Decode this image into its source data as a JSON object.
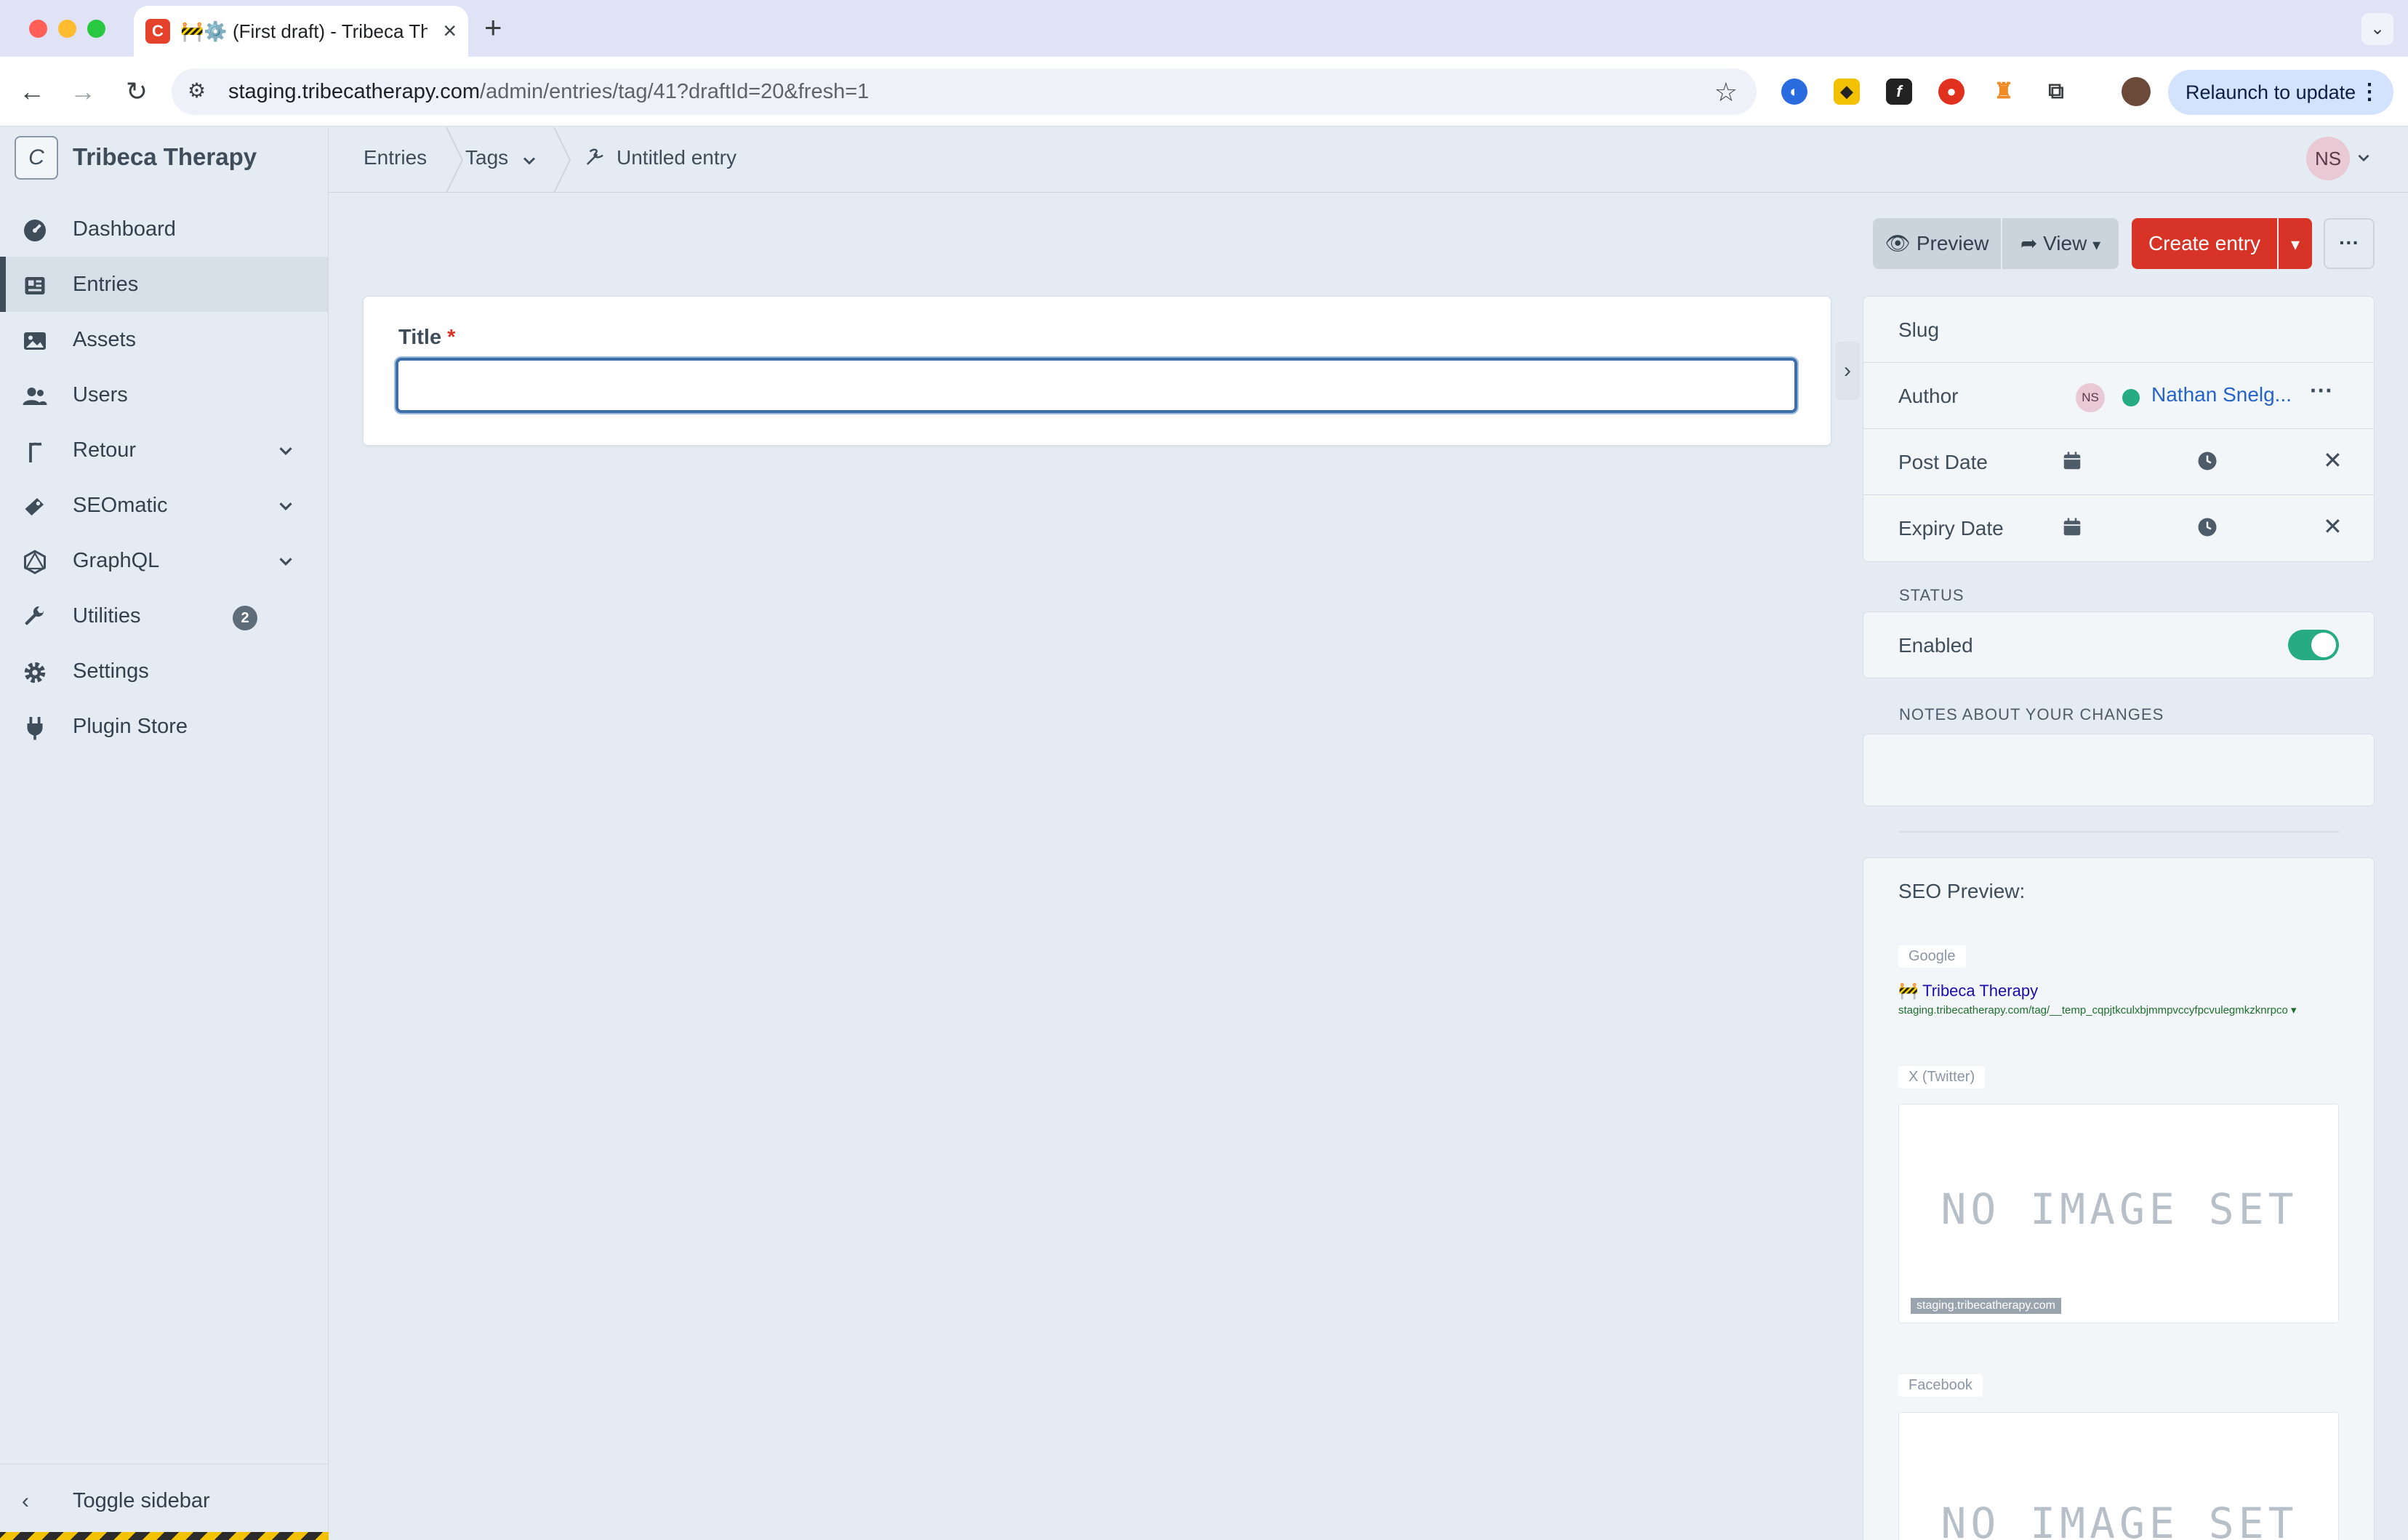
{
  "browser": {
    "tab_title": "🚧⚙️ (First draft) - Tribeca Therapy",
    "favicon_letter": "C",
    "url_host": "staging.tribecatherapy.com",
    "url_path": "/admin/entries/tag/41?draftId=20&fresh=1",
    "relaunch_label": "Relaunch to update",
    "ext_icons": [
      "1password-icon",
      "yellow-diamond-icon",
      "f-icon",
      "red-shield-icon",
      "orange-figure-icon",
      "puzzle-icon"
    ],
    "colors": {
      "tabbar_bg": "#dfe3f5",
      "relaunch_bg": "#d3e3fd"
    }
  },
  "sidebar": {
    "site_name": "Tribeca Therapy",
    "site_icon_letter": "C",
    "items": [
      {
        "label": "Dashboard",
        "icon": "gauge-icon"
      },
      {
        "label": "Entries",
        "icon": "newspaper-icon",
        "active": true
      },
      {
        "label": "Assets",
        "icon": "image-icon"
      },
      {
        "label": "Users",
        "icon": "users-icon"
      },
      {
        "label": "Retour",
        "icon": "signpost-icon",
        "expandable": true
      },
      {
        "label": "SEOmatic",
        "icon": "seomatic-icon",
        "expandable": true
      },
      {
        "label": "GraphQL",
        "icon": "graphql-icon",
        "expandable": true
      },
      {
        "label": "Utilities",
        "icon": "wrench-icon",
        "badge": "2"
      },
      {
        "label": "Settings",
        "icon": "gear-icon"
      },
      {
        "label": "Plugin Store",
        "icon": "plug-icon"
      }
    ],
    "toggle_label": "Toggle sidebar"
  },
  "header": {
    "breadcrumbs": [
      "Entries",
      "Tags",
      "Untitled entry"
    ],
    "user_initials": "NS"
  },
  "actions": {
    "preview_label": "Preview",
    "view_label": "View",
    "create_label": "Create entry",
    "colors": {
      "primary": "#d73427",
      "secondary": "#cbd3dd"
    }
  },
  "form": {
    "title_label": "Title",
    "title_value": ""
  },
  "details": {
    "slug_label": "Slug",
    "author_label": "Author",
    "author_initials": "NS",
    "author_name": "Nathan Snelg...",
    "post_date_label": "Post Date",
    "expiry_date_label": "Expiry Date",
    "status_heading": "STATUS",
    "enabled_label": "Enabled",
    "enabled": true,
    "notes_heading": "NOTES ABOUT YOUR CHANGES",
    "notes_value": "",
    "colors": {
      "toggle_on": "#27ab83",
      "link": "#2563c9"
    }
  },
  "seo": {
    "heading": "SEO Preview:",
    "google_tab": "Google",
    "google_title": "🚧 Tribeca Therapy",
    "google_url": "staging.tribecatherapy.com/tag/__temp_cqpjtkculxbjmmpvccyfpcvulegmkzknrpco ▾",
    "twitter_tab": "X (Twitter)",
    "facebook_tab": "Facebook",
    "no_image_text": "NO IMAGE SET",
    "domain_chip": "staging.tribecatherapy.com"
  }
}
